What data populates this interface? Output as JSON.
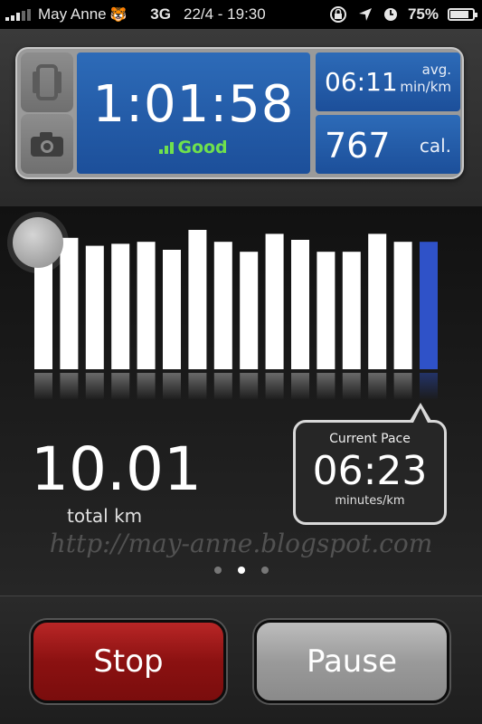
{
  "status_bar": {
    "carrier": "May Anne",
    "carrier_emoji": "🐯",
    "network": "3G",
    "datetime": "22/4 - 19:30",
    "battery_percent": "75%",
    "battery_level": 0.75,
    "icons": [
      "rotation-lock-icon",
      "location-arrow-icon",
      "alarm-clock-icon"
    ]
  },
  "header": {
    "duration": "1:01:58",
    "gps_status": "Good",
    "avg_pace": {
      "value": "06:11",
      "unit_line1": "avg.",
      "unit_line2": "min/km"
    },
    "calories": {
      "value": "767",
      "unit": "cal."
    },
    "buttons": [
      "screen-lock-icon",
      "camera-icon"
    ]
  },
  "chart_data": {
    "type": "bar",
    "series": [
      {
        "values": [
          0.63,
          0.66,
          0.62,
          0.63,
          0.64,
          0.6,
          0.7,
          0.64,
          0.59,
          0.68,
          0.65,
          0.59,
          0.59,
          0.68,
          0.64,
          0.64
        ]
      }
    ],
    "highlight_index": 15,
    "colors": {
      "bar": "#ffffff",
      "highlight": "#2f52c8"
    }
  },
  "stats": {
    "total_distance": "10.01",
    "total_label": "total km",
    "current_pace_title": "Current Pace",
    "current_pace": "06:23",
    "current_pace_unit": "minutes/km"
  },
  "watermark": "http://may-anne.blogspot.com",
  "page_indicator": {
    "count": 3,
    "active": 2
  },
  "actions": {
    "stop_label": "Stop",
    "pause_label": "Pause"
  },
  "colors": {
    "panel_blue": "#2d6bb8",
    "gps_green": "#6fe04d",
    "stop_red": "#b82626",
    "pause_gray": "#a6a6a6"
  }
}
